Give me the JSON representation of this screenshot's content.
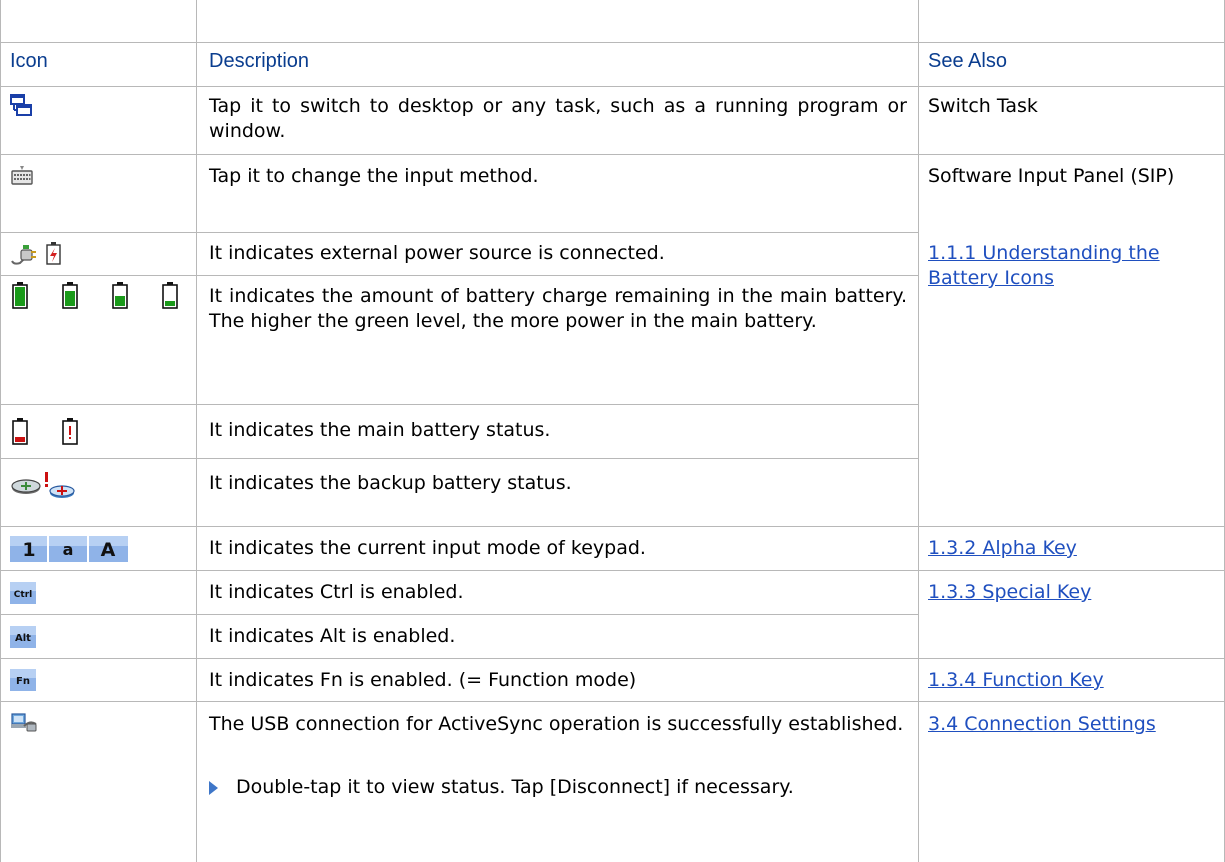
{
  "headers": {
    "icon": "Icon",
    "description": "Description",
    "see_also": "See Also"
  },
  "rows": [
    {
      "icon": "task-switch-icon",
      "description": "Tap it to switch to desktop or any task, such as a running program or window.",
      "see_also": "Switch Task"
    },
    {
      "icon": "keyboard-icon",
      "description": "Tap it to change the input method.",
      "see_also": "Software Input Panel (SIP)"
    },
    {
      "icon": "power-plug-icon",
      "description": "It indicates external power source is connected.",
      "see_also": "1.1.1 Understanding the Battery Icons"
    },
    {
      "icon": "battery-levels-icon",
      "description": "It indicates the amount of battery charge remaining in the main battery. The higher the green level, the more power in the main battery."
    },
    {
      "icon": "battery-low-icon",
      "description": "It indicates the main battery status."
    },
    {
      "icon": "backup-battery-icon",
      "description": "It indicates the backup battery status."
    },
    {
      "icon": "input-mode-icon",
      "description": "It indicates the current input mode of keypad.",
      "see_also": "1.3.2 Alpha Key"
    },
    {
      "icon": "ctrl-icon",
      "icon_text": "Ctrl",
      "description": "It indicates Ctrl is enabled.",
      "see_also": "1.3.3 Special Key"
    },
    {
      "icon": "alt-icon",
      "icon_text": "Alt",
      "description": "It indicates Alt is enabled."
    },
    {
      "icon": "fn-icon",
      "icon_text": "Fn",
      "description": "It indicates Fn is enabled. (= Function mode)",
      "see_also": "1.3.4 Function Key"
    },
    {
      "icon": "usb-sync-icon",
      "description": "The USB connection for ActiveSync operation is successfully established.",
      "bullet": "Double-tap it to view status. Tap [Disconnect] if necessary.",
      "see_also": "3.4 Connection Settings"
    }
  ],
  "input_mode_keys": [
    "1",
    "a",
    "A"
  ],
  "colors": {
    "header_text": "#0a3d8f",
    "link": "#1f4fbf",
    "grid": "#b8b8b8",
    "battery_green": "#1a9a1a",
    "battery_red": "#cc1111"
  }
}
